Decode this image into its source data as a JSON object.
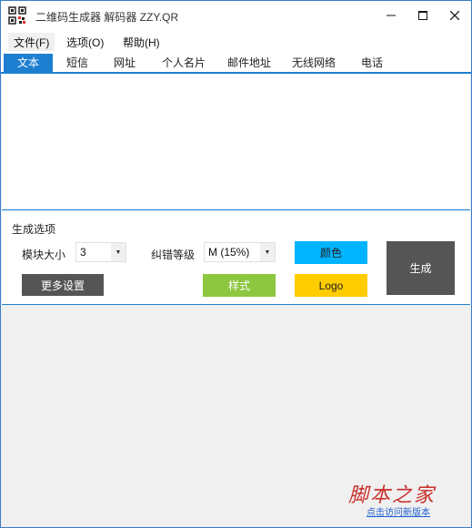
{
  "window": {
    "title": "二维码生成器 解码器 ZZY.QR"
  },
  "window_controls": {
    "minimize": "—",
    "maximize": "☐",
    "close": "✕"
  },
  "menu": [
    {
      "label": "文件(F)"
    },
    {
      "label": "选项(O)"
    },
    {
      "label": "帮助(H)"
    }
  ],
  "tabs": [
    {
      "label": "文本",
      "active": true
    },
    {
      "label": "短信"
    },
    {
      "label": "网址"
    },
    {
      "label": "个人名片"
    },
    {
      "label": "邮件地址"
    },
    {
      "label": "无线网络"
    },
    {
      "label": "电话"
    }
  ],
  "text_input": {
    "value": ""
  },
  "options": {
    "section_title": "生成选项",
    "module_size_label": "模块大小",
    "module_size_value": "3",
    "error_level_label": "纠错等级",
    "error_level_value": "M (15%)"
  },
  "buttons": {
    "color": "颜色",
    "logo": "Logo",
    "style": "样式",
    "more_settings": "更多设置",
    "generate": "生成"
  },
  "colors": {
    "accent": "#1e7fd0",
    "color_button": "#00b4ff",
    "logo_button": "#ffcc00",
    "style_button": "#8dc63f",
    "dark_button": "#555555",
    "watermark": "#c9302c"
  },
  "watermark": {
    "main": "脚本之家",
    "sub": "点击访问新版本"
  }
}
